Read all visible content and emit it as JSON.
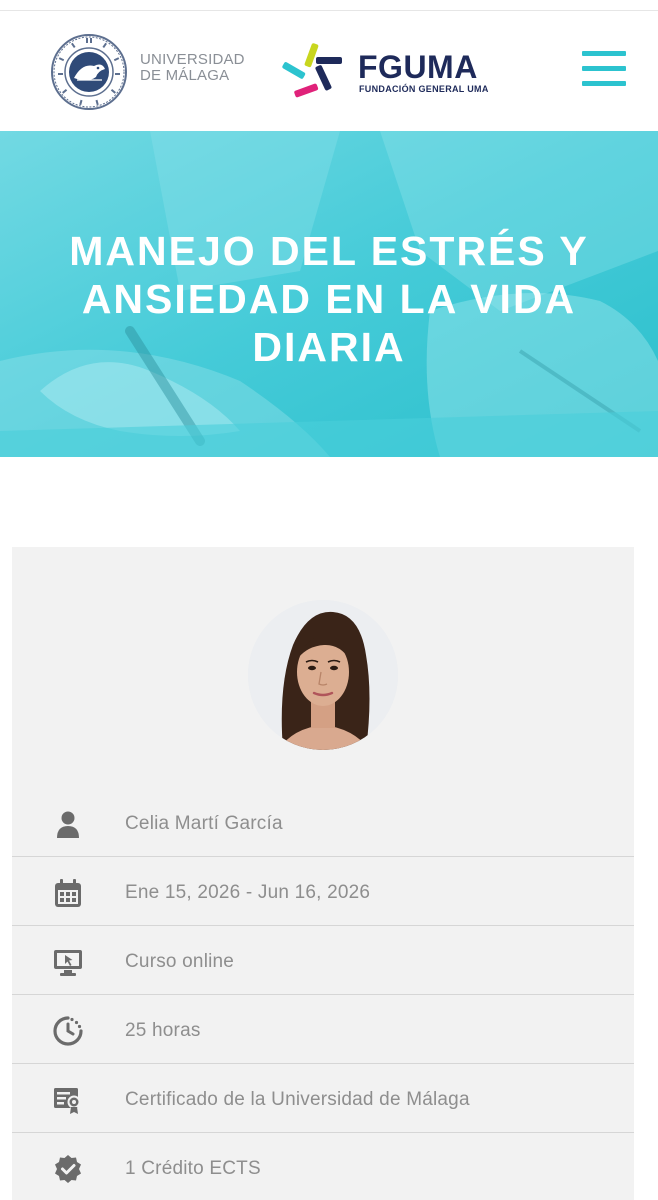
{
  "header": {
    "university_line1": "UNIVERSIDAD",
    "university_line2": "DE MÁLAGA",
    "foundation_name": "FGUMA",
    "foundation_subtitle": "FUNDACIÓN GENERAL UMA",
    "menu_icon": "hamburger-menu-icon"
  },
  "hero": {
    "title": "MANEJO DEL ESTRÉS Y ANSIEDAD EN LA VIDA DIARIA"
  },
  "course_info": [
    {
      "icon": "user-icon",
      "text": "Celia Martí García"
    },
    {
      "icon": "calendar-icon",
      "text": "Ene 15, 2026 - Jun 16, 2026"
    },
    {
      "icon": "monitor-icon",
      "text": "Curso online"
    },
    {
      "icon": "clock-icon",
      "text": "25 horas"
    },
    {
      "icon": "certificate-icon",
      "text": "Certificado de la Universidad de Málaga"
    },
    {
      "icon": "badge-check-icon",
      "text": "1 Crédito ECTS"
    }
  ],
  "colors": {
    "accent": "#2cc3cf",
    "brand_navy": "#1e2a5a",
    "hero": "#3ccad7",
    "card_bg": "#f2f2f2",
    "info_text": "#8e8e8e",
    "icon": "#6b6b6b"
  }
}
